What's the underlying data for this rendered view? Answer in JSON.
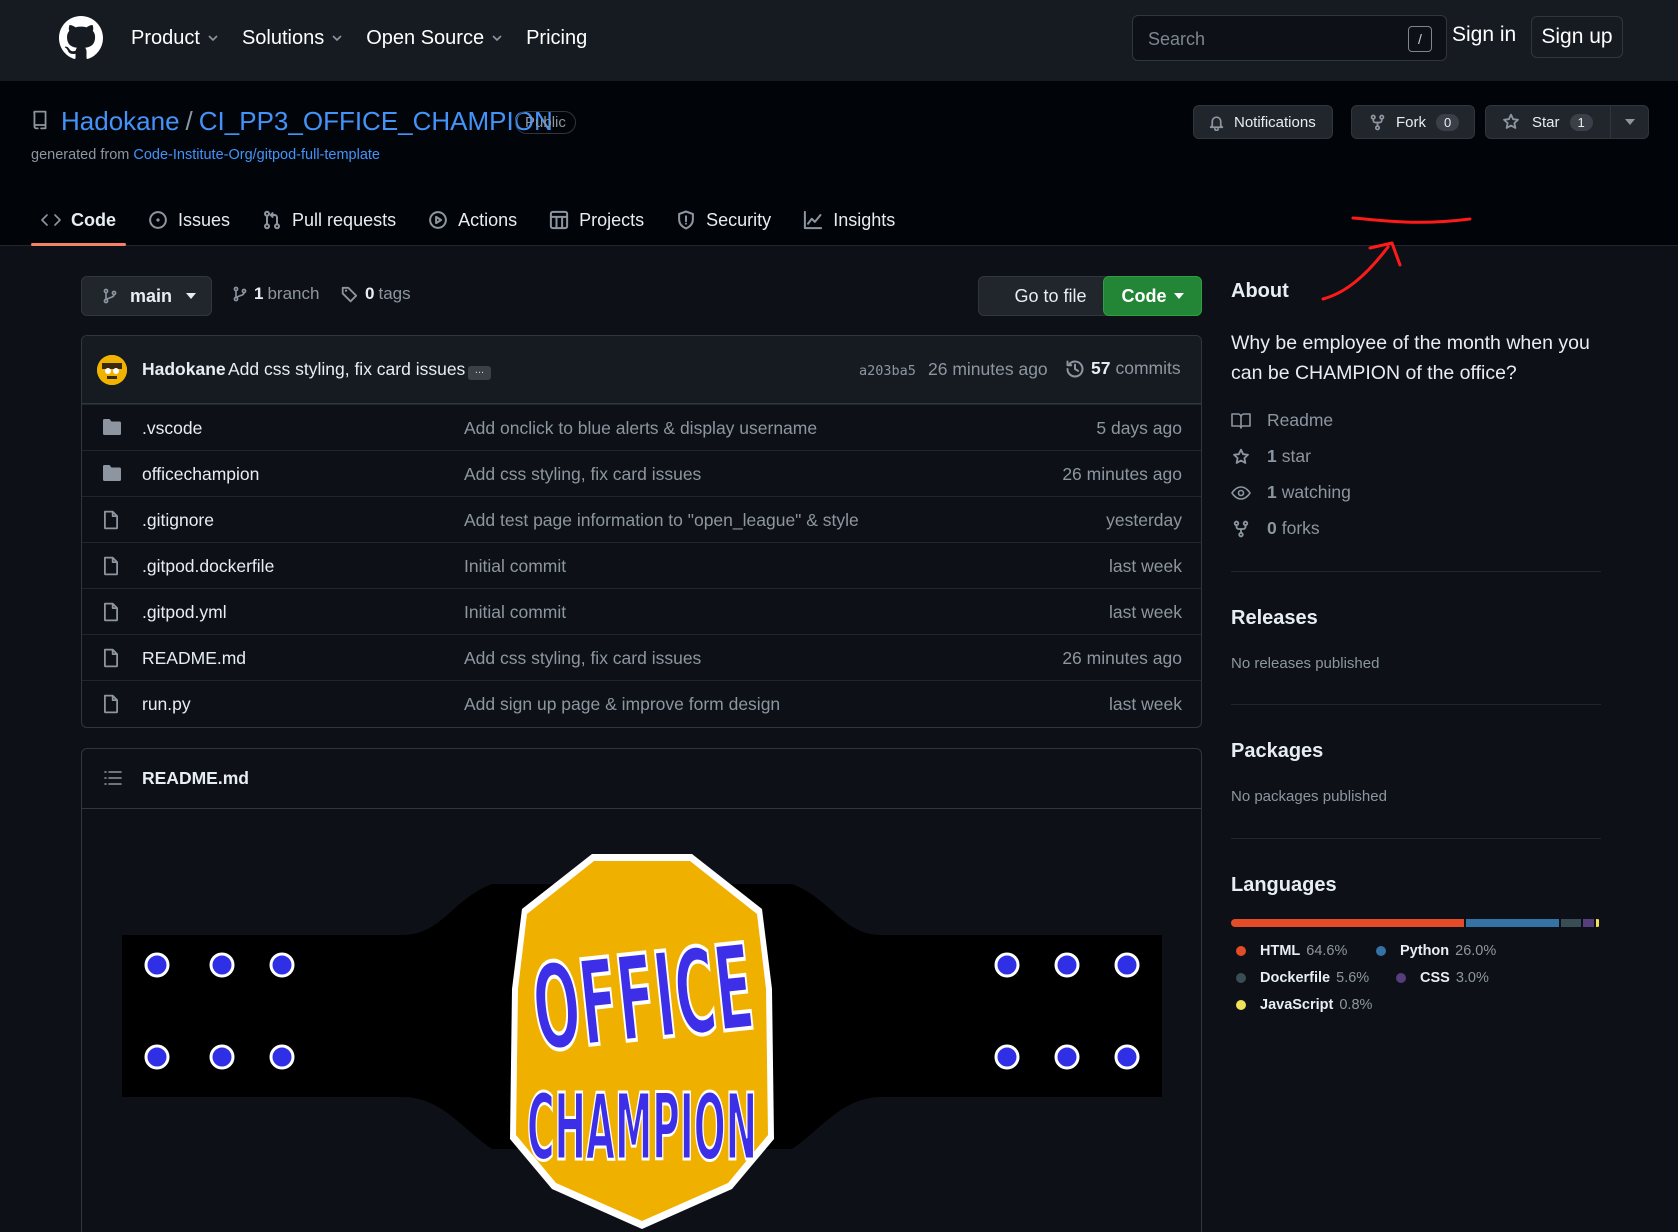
{
  "nav": {
    "items": [
      "Product",
      "Solutions",
      "Open Source",
      "Pricing"
    ],
    "search_placeholder": "Search",
    "search_shortcut": "/",
    "sign_in": "Sign in",
    "sign_up": "Sign up"
  },
  "repo": {
    "owner": "Hadokane",
    "separator": "/",
    "name": "CI_PP3_OFFICE_CHAMPION",
    "visibility": "Public",
    "generated_from_prefix": "generated from ",
    "generated_from_link": "Code-Institute-Org/gitpod-full-template",
    "notifications_label": "Notifications",
    "fork_label": "Fork",
    "fork_count": "0",
    "star_label": "Star",
    "star_count": "1"
  },
  "tabs": [
    "Code",
    "Issues",
    "Pull requests",
    "Actions",
    "Projects",
    "Security",
    "Insights"
  ],
  "toolbar": {
    "branch": "main",
    "branch_count": "1",
    "branch_label": "branch",
    "tag_count": "0",
    "tag_label": "tags",
    "go_to_file": "Go to file",
    "code_button": "Code"
  },
  "latest_commit": {
    "author": "Hadokane",
    "message": "Add css styling, fix card issues",
    "ellipsis": "...",
    "sha": "a203ba5",
    "time": "26 minutes ago",
    "commit_count": "57",
    "commit_label": "commits"
  },
  "files": [
    {
      "type": "folder",
      "name": ".vscode",
      "commit": "Add onclick to blue alerts & display username",
      "time": "5 days ago"
    },
    {
      "type": "folder",
      "name": "officechampion",
      "commit": "Add css styling, fix card issues",
      "time": "26 minutes ago"
    },
    {
      "type": "file",
      "name": ".gitignore",
      "commit": "Add test page information to \"open_league\" & style",
      "time": "yesterday"
    },
    {
      "type": "file",
      "name": ".gitpod.dockerfile",
      "commit": "Initial commit",
      "time": "last week"
    },
    {
      "type": "file",
      "name": ".gitpod.yml",
      "commit": "Initial commit",
      "time": "last week"
    },
    {
      "type": "file",
      "name": "README.md",
      "commit": "Add css styling, fix card issues",
      "time": "26 minutes ago"
    },
    {
      "type": "file",
      "name": "run.py",
      "commit": "Add sign up page & improve form design",
      "time": "last week"
    }
  ],
  "readme": {
    "title": "README.md",
    "belt_line1": "OFFICE",
    "belt_line2": "CHAMPION"
  },
  "about": {
    "heading": "About",
    "description": "Why be employee of the month when you can be CHAMPION of the office?",
    "readme_label": "Readme",
    "stars_count": "1",
    "stars_label": "star",
    "watching_count": "1",
    "watching_label": "watching",
    "forks_count": "0",
    "forks_label": "forks"
  },
  "releases": {
    "heading": "Releases",
    "text": "No releases published"
  },
  "packages": {
    "heading": "Packages",
    "text": "No packages published"
  },
  "languages": {
    "heading": "Languages",
    "items": [
      {
        "name": "HTML",
        "percent": "64.6%",
        "value": 64.6,
        "color": "#e34c26"
      },
      {
        "name": "Python",
        "percent": "26.0%",
        "value": 26.0,
        "color": "#3572A5"
      },
      {
        "name": "Dockerfile",
        "percent": "5.6%",
        "value": 5.6,
        "color": "#384d54"
      },
      {
        "name": "CSS",
        "percent": "3.0%",
        "value": 3.0,
        "color": "#563d7c"
      },
      {
        "name": "JavaScript",
        "percent": "0.8%",
        "value": 0.8,
        "color": "#f1e05a"
      }
    ]
  },
  "colors": {
    "accent": "#4493f8",
    "primary_button": "#238636",
    "tab_underline": "#f78166",
    "annotation": "#ff1a1a"
  }
}
